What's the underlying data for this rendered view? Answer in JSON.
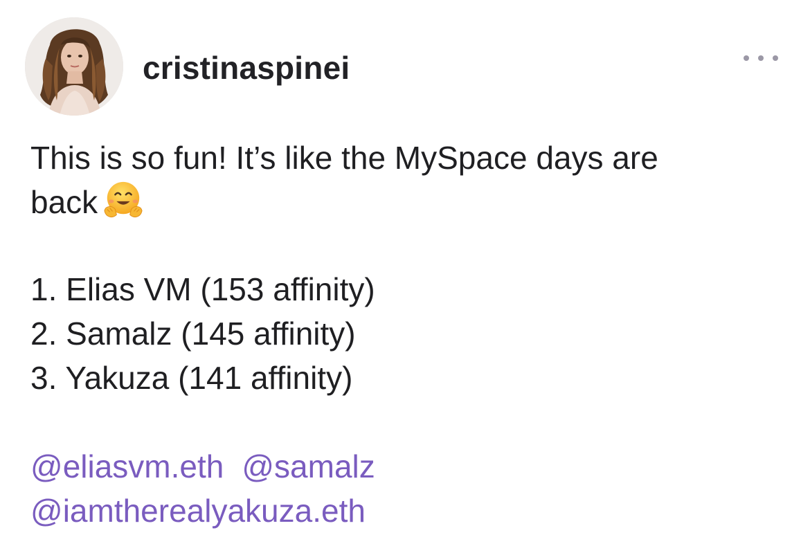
{
  "post": {
    "author": {
      "username": "cristinaspinei",
      "avatar_icon": "profile-photo"
    },
    "menu_icon": "more-horizontal-icon",
    "text_lines": [
      "This is so fun! It’s like the MySpace days are",
      "back"
    ],
    "emoji": "hugging-face-emoji",
    "list": [
      "1. Elias VM (153 affinity)",
      "2. Samalz (145 affinity)",
      "3. Yakuza (141 affinity)"
    ],
    "mentions": [
      "@eliasvm.eth",
      "@samalz",
      "@iamtherealyakuza.eth"
    ]
  },
  "colors": {
    "text": "#1f1f22",
    "mention": "#7a5cbf",
    "menu_dots": "#9b98a6",
    "background": "#ffffff"
  }
}
